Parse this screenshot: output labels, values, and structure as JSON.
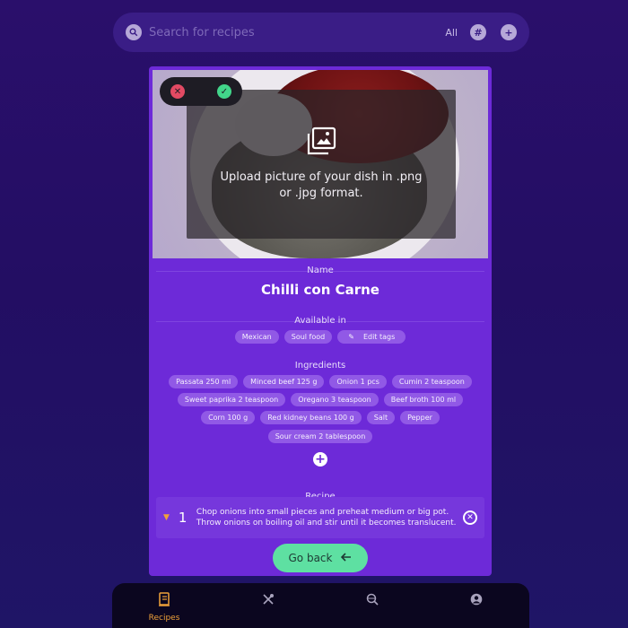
{
  "search": {
    "placeholder": "Search for recipes",
    "filter_label": "All",
    "hash_symbol": "#",
    "add_symbol": "+"
  },
  "image_toggle": {
    "cancel_icon": "close-icon",
    "confirm_icon": "check-icon"
  },
  "upload": {
    "icon": "image-gallery-icon",
    "text": "Upload picture of your dish in .png or .jpg format."
  },
  "name": {
    "label": "Name",
    "value": "Chilli con Carne"
  },
  "available_in": {
    "label": "Available in",
    "tags": [
      "Mexican",
      "Soul food"
    ],
    "edit_label": "Edit tags"
  },
  "ingredients": {
    "label": "Ingredients",
    "rows": [
      [
        "Passata 250 ml",
        "Minced beef 125 g",
        "Onion 1 pcs",
        "Cumin 2 teaspoon"
      ],
      [
        "Sweet paprika 2 teaspoon",
        "Oregano 3 teaspoon",
        "Beef broth 100 ml"
      ],
      [
        "Corn 100 g",
        "Red kidney beans 100 g",
        "Salt",
        "Pepper"
      ],
      [
        "Sour cream 2 tablespoon"
      ]
    ]
  },
  "recipe": {
    "label": "Recipe",
    "steps": [
      {
        "number": "1",
        "text": "Chop onions into small pieces and preheat medium or big pot. Throw onions on boiling oil and stir until it becomes translucent."
      }
    ]
  },
  "go_back": {
    "label": "Go back"
  },
  "nav": {
    "items": [
      {
        "label": "Recipes",
        "icon": "book-icon",
        "active": true
      },
      {
        "label": "",
        "icon": "utensils-icon",
        "active": false
      },
      {
        "label": "",
        "icon": "globe-search-icon",
        "active": false
      },
      {
        "label": "",
        "icon": "user-icon",
        "active": false
      }
    ]
  },
  "colors": {
    "background": "#230e63",
    "card": "#6d2ad8",
    "accent_green": "#5ee0a2",
    "accent_orange": "#f0a23a",
    "cancel_red": "#e24a63",
    "confirm_green": "#42d58a"
  }
}
